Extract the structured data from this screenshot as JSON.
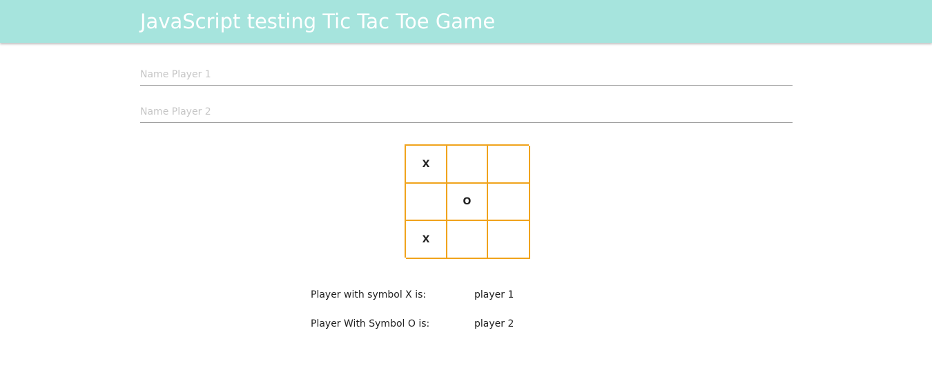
{
  "header": {
    "title": "JavaScript testing Tic Tac Toe Game"
  },
  "form": {
    "player1_placeholder": "Name Player 1",
    "player1_value": "",
    "player2_placeholder": "Name Player 2",
    "player2_value": ""
  },
  "board": {
    "cells": [
      "X",
      "",
      "",
      "",
      "O",
      "",
      "X",
      "",
      ""
    ]
  },
  "info": {
    "symbol_x_label": "Player with symbol X is:",
    "symbol_x_player": "player 1",
    "symbol_o_label": "Player With Symbol O is:",
    "symbol_o_player": "player 2"
  },
  "colors": {
    "header_bg": "#a6e4dd",
    "board_border": "#f0a31c"
  }
}
